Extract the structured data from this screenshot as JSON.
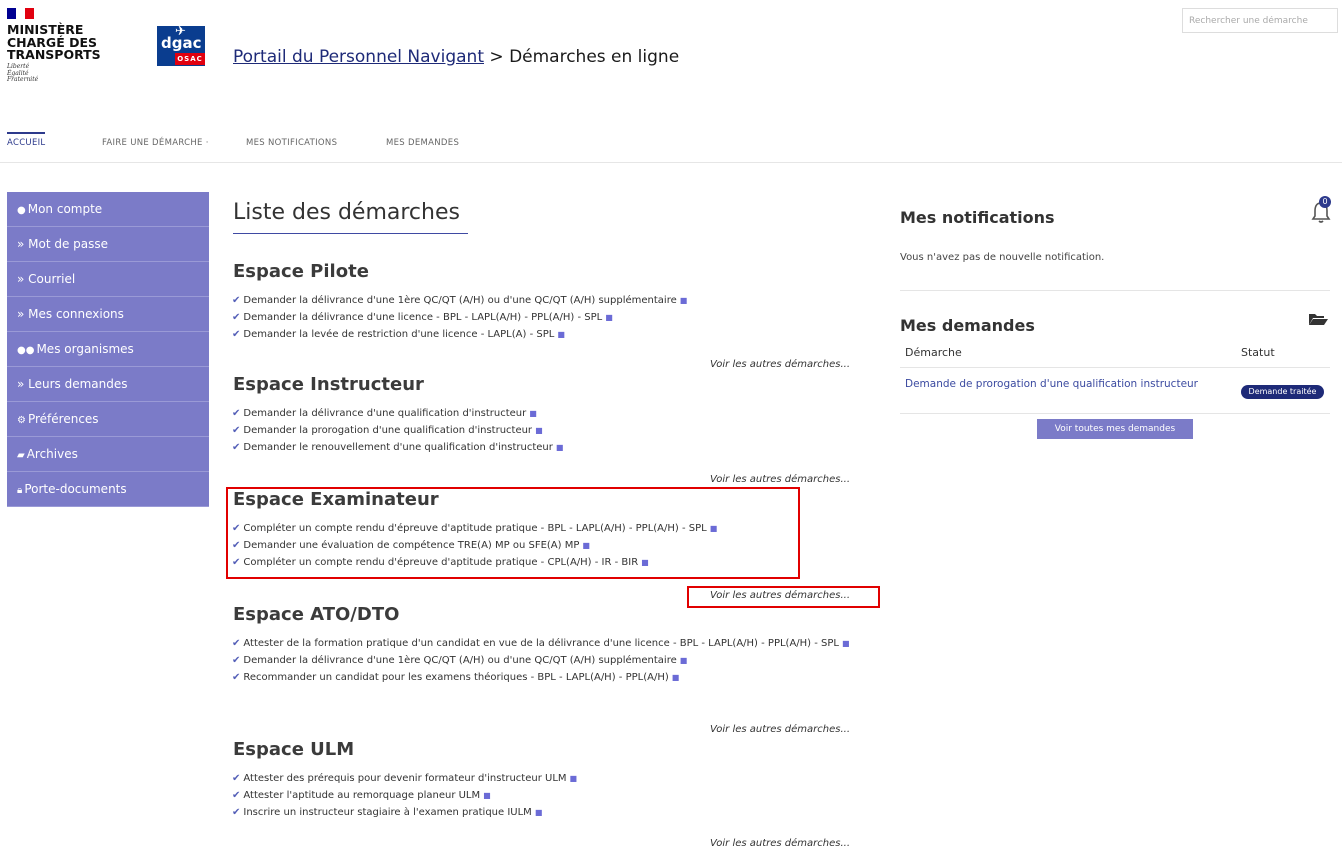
{
  "header": {
    "ministry": "MINISTÈRE CHARGÉ DES TRANSPORTS",
    "motto": [
      "Liberté",
      "Égalité",
      "Fraternité"
    ],
    "dgac_name": "dgac",
    "dgac_sub": "OSAC",
    "portal_link": "Portail du Personnel Navigant",
    "breadcrumb_sep": " > ",
    "breadcrumb_current": "Démarches en ligne",
    "search_placeholder": "Rechercher une démarche"
  },
  "topnav": [
    {
      "label": "ACCUEIL",
      "active": true
    },
    {
      "label": "FAIRE UNE DÉMARCHE ·",
      "active": false
    },
    {
      "label": "MES NOTIFICATIONS",
      "active": false
    },
    {
      "label": "MES DEMANDES",
      "active": false
    }
  ],
  "sidebar": [
    {
      "label": "Mon compte",
      "prefix": "",
      "icon": "user-icon"
    },
    {
      "label": "Mot de passe",
      "prefix": "» ",
      "icon": ""
    },
    {
      "label": "Courriel",
      "prefix": "» ",
      "icon": ""
    },
    {
      "label": "Mes connexions",
      "prefix": "» ",
      "icon": ""
    },
    {
      "label": "Mes organismes",
      "prefix": "",
      "icon": "group-icon"
    },
    {
      "label": "Leurs demandes",
      "prefix": "» ",
      "icon": ""
    },
    {
      "label": "Préférences",
      "prefix": "",
      "icon": "gears-icon"
    },
    {
      "label": "Archives",
      "prefix": "",
      "icon": "folder-icon"
    },
    {
      "label": "Porte-documents",
      "prefix": "",
      "icon": "lock-icon"
    }
  ],
  "main": {
    "heading": "Liste des démarches",
    "more_label": "Voir les autres démarches...",
    "sections": [
      {
        "title": "Espace Pilote",
        "items": [
          "Demander la délivrance d'une 1ère QC/QT (A/H) ou d'une QC/QT (A/H) supplémentaire",
          "Demander la délivrance d'une licence - BPL - LAPL(A/H) - PPL(A/H) - SPL",
          "Demander la levée de restriction d'une licence - LAPL(A) - SPL"
        ]
      },
      {
        "title": "Espace Instructeur",
        "items": [
          "Demander la délivrance d'une qualification d'instructeur",
          "Demander la prorogation d'une qualification d'instructeur",
          "Demander le renouvellement d'une qualification d'instructeur"
        ]
      },
      {
        "title": "Espace Examinateur",
        "items": [
          "Compléter un compte rendu d'épreuve d'aptitude pratique - BPL - LAPL(A/H) - PPL(A/H) - SPL",
          "Demander une évaluation de compétence TRE(A) MP ou SFE(A) MP",
          "Compléter un compte rendu d'épreuve d'aptitude pratique - CPL(A/H) - IR - BIR"
        ]
      },
      {
        "title": "Espace ATO/DTO",
        "items": [
          "Attester de la formation pratique d'un candidat en vue de la délivrance d'une licence - BPL - LAPL(A/H) - PPL(A/H) - SPL",
          "Demander la délivrance d'une 1ère QC/QT (A/H) ou d'une QC/QT (A/H) supplémentaire",
          "Recommander un candidat pour les examens théoriques - BPL - LAPL(A/H) - PPL(A/H)"
        ]
      },
      {
        "title": "Espace ULM",
        "items": [
          "Attester des prérequis pour devenir formateur d'instructeur ULM",
          "Attester l'aptitude au remorquage planeur ULM",
          "Inscrire un instructeur stagiaire à l'examen pratique IULM"
        ]
      }
    ]
  },
  "notifications": {
    "title": "Mes notifications",
    "badge_count": "0",
    "empty_text": "Vous n'avez pas de nouvelle notification."
  },
  "requests": {
    "title": "Mes demandes",
    "col_demarche": "Démarche",
    "col_statut": "Statut",
    "rows": [
      {
        "demarche": "Demande de prorogation d'une qualification instructeur",
        "statut": "Demande traitée"
      }
    ],
    "see_all": "Voir toutes mes demandes"
  },
  "colors": {
    "sidebar_bg": "#7b7bc8",
    "accent": "#2d3a8c",
    "highlight": "#e10000"
  }
}
